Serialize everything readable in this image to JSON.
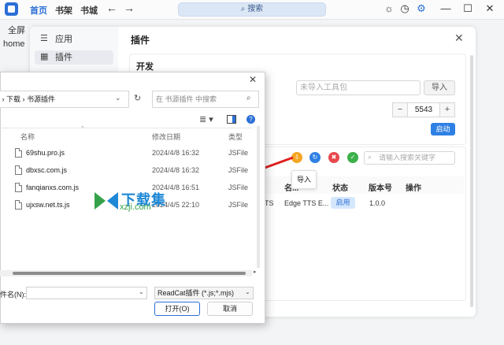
{
  "topbar": {
    "tabs": [
      "首页",
      "书架",
      "书城"
    ],
    "back_icon": "arrow-left-icon",
    "forward_icon": "arrow-right-icon",
    "search_placeholder": "搜索",
    "icons": [
      "sun-icon",
      "history-icon",
      "settings-icon",
      "minimize-icon",
      "maximize-icon",
      "close-icon"
    ]
  },
  "left_strip": {
    "fullscreen": "全屏",
    "home": "home"
  },
  "settings": {
    "sidebar": [
      {
        "label": "应用",
        "icon": "sliders-icon"
      },
      {
        "label": "插件",
        "icon": "grid-icon"
      }
    ],
    "title": "插件",
    "dev": {
      "title": "开发",
      "tool_placeholder": "未导入工具包",
      "import_label": "导入",
      "port_value": "5543",
      "port_minus": "−",
      "port_plus": "+",
      "start_label": "启动"
    },
    "plugins": {
      "search_placeholder": "请输入搜索关键字",
      "tooltip": "导入",
      "action_colors": [
        "#f5a623",
        "#2f80e4",
        "#e8484d",
        "#3cb04a"
      ],
      "columns": [
        "名...",
        "状态",
        "版本号",
        "操作"
      ],
      "row": {
        "prefix": "TS",
        "name": "Edge TTS E...",
        "status": "启用",
        "version": "1.0.0"
      }
    }
  },
  "dialog": {
    "path": [
      "下载",
      "书源插件"
    ],
    "search_placeholder": "在 书源插件 中搜索",
    "columns": {
      "name": "名称",
      "date": "修改日期",
      "type": "类型"
    },
    "files": [
      {
        "name": "69shu.pro.js",
        "date": "2024/4/8 16:32",
        "type": "JSFile"
      },
      {
        "name": "dbxsc.com.js",
        "date": "2024/4/8 16:32",
        "type": "JSFile"
      },
      {
        "name": "fanqianxs.com.js",
        "date": "2024/4/8 16:51",
        "type": "JSFile"
      },
      {
        "name": "ujxsw.net.ts.js",
        "date": "2024/4/5 22:10",
        "type": "JSFile"
      }
    ],
    "filename_label": "件名(N):",
    "filetype": "ReadCat插件 (*.js;*.mjs)",
    "open_label": "打开(O)",
    "cancel_label": "取消"
  },
  "watermark": {
    "text": "下载集",
    "url": "xzji.com"
  }
}
